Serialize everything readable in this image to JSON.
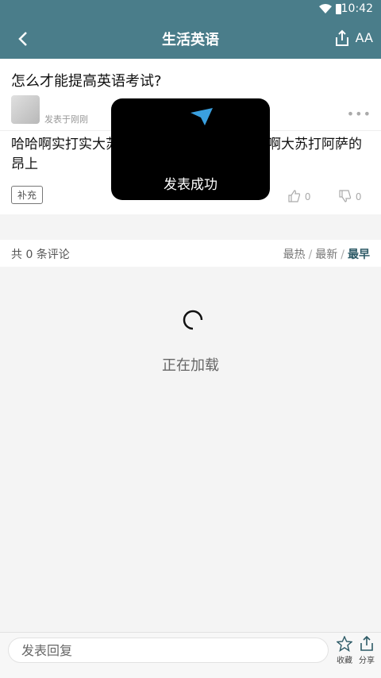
{
  "status": {
    "time": "10:42"
  },
  "header": {
    "title": "生活英语",
    "font_icon": "AA"
  },
  "question": {
    "title": "怎么才能提高英语考试?",
    "meta": "发表于刚刚",
    "body": "哈哈啊实打实大苏打阿萨打啊大苏打阿萨打啊大苏打阿萨的昂上",
    "supplement_label": "补充",
    "likes": "0",
    "dislikes": "0"
  },
  "comments": {
    "count_text": "共 0 条评论",
    "sort": [
      "最热",
      "最新",
      "最早"
    ],
    "active_sort": "最早",
    "loading_text": "正在加载"
  },
  "toast": {
    "message": "发表成功"
  },
  "footer": {
    "reply_placeholder": "发表回复",
    "favorite_label": "收藏",
    "share_label": "分享"
  },
  "colors": {
    "header": "#4a7d8a",
    "accent": "#2d5a66",
    "toast_icon": "#3aa0e0"
  }
}
